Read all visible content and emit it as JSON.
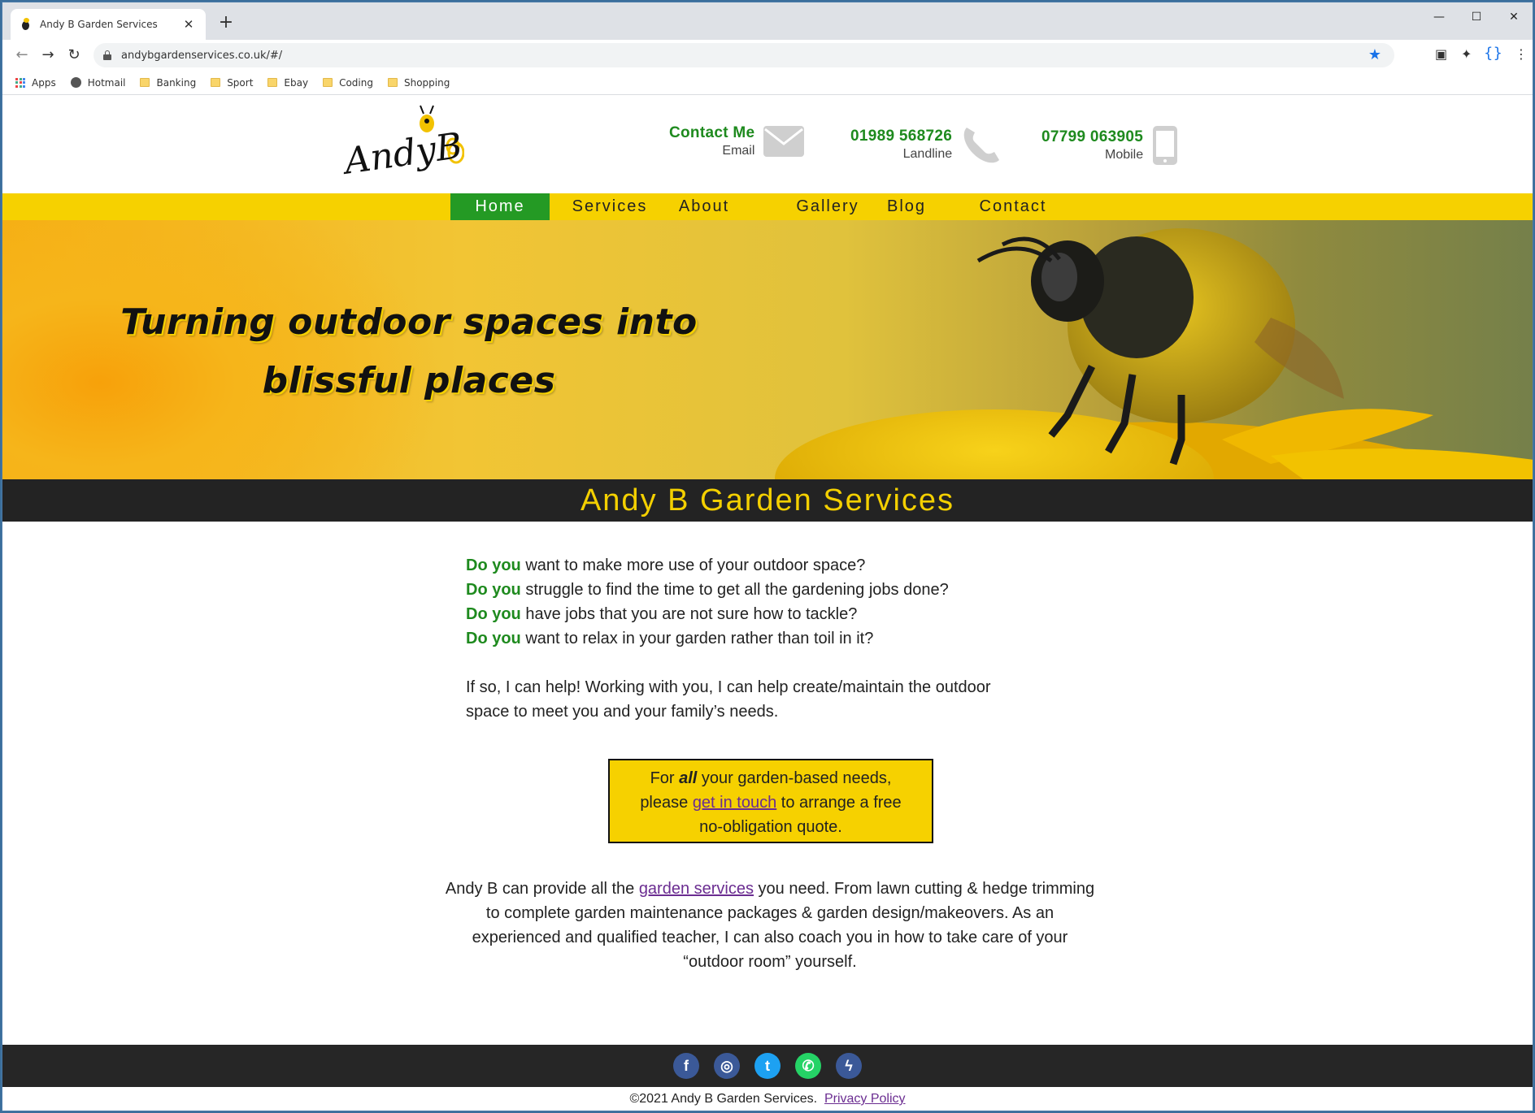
{
  "browser": {
    "tab_title": "Andy B Garden Services",
    "url": "andybgardenservices.co.uk/#/",
    "bookmarks": [
      {
        "label": "Apps",
        "icon": "apps-grid-icon"
      },
      {
        "label": "Hotmail",
        "icon": "globe-icon"
      },
      {
        "label": "Banking",
        "icon": "folder-icon"
      },
      {
        "label": "Sport",
        "icon": "folder-icon"
      },
      {
        "label": "Ebay",
        "icon": "folder-icon"
      },
      {
        "label": "Coding",
        "icon": "folder-icon"
      },
      {
        "label": "Shopping",
        "icon": "folder-icon"
      }
    ]
  },
  "header": {
    "logo_text": "AndyB",
    "contacts": [
      {
        "main": "Contact Me",
        "sub": "Email",
        "icon": "envelope-icon"
      },
      {
        "main": "01989 568726",
        "sub": "Landline",
        "icon": "phone-icon"
      },
      {
        "main": "07799 063905",
        "sub": "Mobile",
        "icon": "mobile-icon"
      }
    ]
  },
  "nav": {
    "items": [
      "Home",
      "Services",
      "About",
      "Gallery",
      "Blog",
      "Contact"
    ],
    "active": "Home"
  },
  "hero": {
    "line1": "Turning outdoor spaces into",
    "line2": "blissful places"
  },
  "main": {
    "title": "Andy B Garden Services",
    "questions": [
      {
        "lead": "Do you",
        "rest": " want to make more use of your outdoor space?"
      },
      {
        "lead": "Do you",
        "rest": " struggle to find the time to get all the gardening jobs done?"
      },
      {
        "lead": "Do you",
        "rest": " have jobs that you are not sure how to tackle?"
      },
      {
        "lead": "Do you",
        "rest": " want to relax in your garden rather than toil in it?"
      }
    ],
    "help_line1": "If so, I can help! Working with you, I can help create/maintain the outdoor",
    "help_line2": "space to meet you and your family’s needs.",
    "cta": {
      "pre": "For ",
      "emph": "all",
      "post1": " your garden-based needs,",
      "pre2": "please ",
      "link": "get in touch",
      "post2": " to arrange a free",
      "line3": "no-obligation quote."
    },
    "services": {
      "pre": "Andy B can provide all the ",
      "link": "garden services",
      "post1": " you need. From lawn cutting & hedge trimming",
      "line2": "to complete garden maintenance packages & garden design/makeovers. As an",
      "line3": "experienced and qualified teacher, I can also coach you in how to take care of your",
      "line4": "“outdoor room” yourself."
    }
  },
  "footer": {
    "social": [
      {
        "name": "facebook-icon",
        "glyph": "f",
        "color": "#3b5998"
      },
      {
        "name": "instagram-icon",
        "glyph": "◎",
        "color": "#3b5998"
      },
      {
        "name": "twitter-icon",
        "glyph": "t",
        "color": "#1da1f2"
      },
      {
        "name": "whatsapp-icon",
        "glyph": "✆",
        "color": "#25d366"
      },
      {
        "name": "messenger-icon",
        "glyph": "ϟ",
        "color": "#3b5998"
      }
    ],
    "copyright": "©2021 Andy B Garden Services.",
    "privacy": "Privacy Policy"
  },
  "colors": {
    "brand_yellow": "#f6d100",
    "brand_green": "#1e8a1e",
    "dark_bar": "#232323"
  }
}
